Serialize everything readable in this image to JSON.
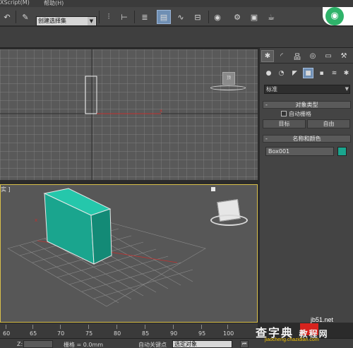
{
  "menu": {
    "items": [
      "XScript(M)",
      "帮助(H)"
    ]
  },
  "toolbar": {
    "selection_set": "创建选择集",
    "buttons": [
      "undo-icon",
      "redo-icon",
      "abc-icon",
      "mirror-icon",
      "align-icon",
      "layer-icon",
      "scene-explorer-icon",
      "curve-editor-icon",
      "schematic-icon",
      "material-editor-icon",
      "render-setup-icon",
      "render-frame-icon",
      "render-icon"
    ]
  },
  "viewport_top": {
    "label": ""
  },
  "viewport_persp": {
    "label": "实 ]",
    "object_color": "#1aa58e"
  },
  "command_panel": {
    "tabs": [
      "create-tab",
      "modify-tab",
      "hierarchy-tab",
      "motion-tab",
      "display-tab",
      "utilities-tab"
    ],
    "category": "标准",
    "object_type_header": "对象类型",
    "autogrid_label": "自动栅格",
    "button_target": "目标",
    "button_free": "自由",
    "name_color_header": "名称和颜色",
    "object_name": "Box001",
    "object_color": "#1aa58e",
    "rollout_minus": "-"
  },
  "timeline": {
    "ticks": [
      "60",
      "65",
      "70",
      "75",
      "80",
      "85",
      "90",
      "95",
      "100"
    ]
  },
  "status": {
    "z_label": "Z:",
    "grid_label": "栅格 = 0.0mm",
    "autokey_label": "自动关键点",
    "selection_filter": "选定对象"
  },
  "watermark": {
    "site": "jb51.net",
    "big": "查字典",
    "box": "教程网",
    "small": "jiaocheng.chazidian.com"
  }
}
